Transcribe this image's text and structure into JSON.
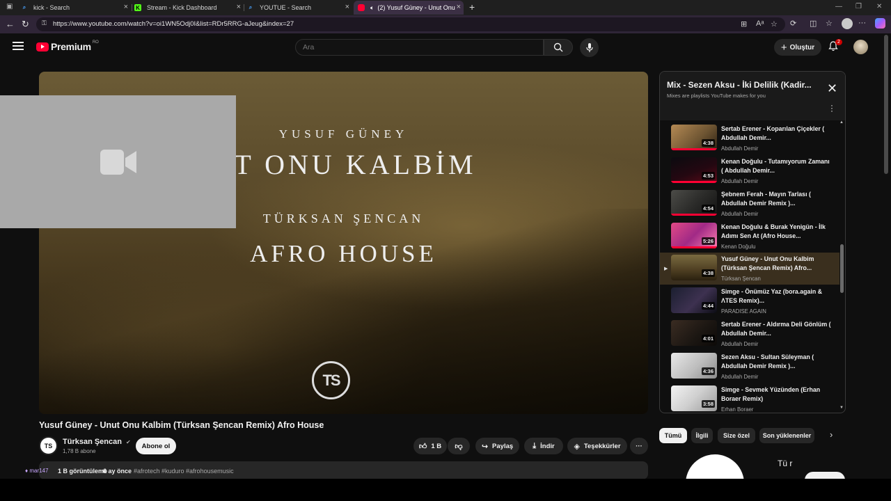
{
  "browser": {
    "tabs": [
      {
        "title": "kick - Search",
        "fav": "search-icon"
      },
      {
        "title": "Stream - Kick Dashboard",
        "fav": "K"
      },
      {
        "title": "YOUTUE - Search",
        "fav": "search-icon"
      },
      {
        "title": "(2) Yusuf Güney - Unut Onu",
        "fav": "youtube-icon"
      }
    ],
    "url": "https://www.youtube.com/watch?v=oi1WN5Odj0I&list=RDr5RRG-aJeug&index=27"
  },
  "header": {
    "logo_text": "Premium",
    "logo_region": "RO",
    "search_placeholder": "Ara",
    "create_label": "Oluştur",
    "notification_count": "2"
  },
  "video": {
    "overlay": {
      "line1": "YUSUF GÜNEY",
      "line2": "UT ONU KALBİM",
      "line3": "TÜRKSAN ŞENCAN",
      "line4": "AFRO HOUSE",
      "logo": "TS"
    },
    "title": "Yusuf Güney - Unut Onu Kalbim (Türksan Şencan Remix) Afro House",
    "channel": "Türksan Şencan",
    "channel_avatar": "TS",
    "subscribers": "1,78 B abone",
    "subscribe_label": "Abone ol",
    "likes": "1 B",
    "share_label": "Paylaş",
    "download_label": "İndir",
    "thanks_label": "Teşekkürler",
    "views": "1 B görüntüleme",
    "age": "6 ay önce",
    "hashtags": "#afrotech #kuduro #afrohousemusic",
    "chat_ghost": "mar147"
  },
  "playlist": {
    "title": "Mix - Sezen Aksu - İki Delilik (Kadir...",
    "subtitle": "Mixes are playlists YouTube makes for you",
    "items": [
      {
        "title": "Sertab Erener - Koparılan Çiçekler ( Abdullah Demir...",
        "channel": "Abdullah Demir",
        "duration": "4:38"
      },
      {
        "title": "Kenan Doğulu - Tutamıyorum Zamanı ( Abdullah Demir...",
        "channel": "Abdullah Demir",
        "duration": "4:53"
      },
      {
        "title": "Şebnem Ferah - Mayın Tarlası ( Abdullah Demir Remix )...",
        "channel": "Abdullah Demir",
        "duration": "4:54"
      },
      {
        "title": "Kenan Doğulu & Burak Yenigün - İlk Adımı Sen At (Afro House...",
        "channel": "Kenan Doğulu",
        "duration": "5:26"
      },
      {
        "title": "Yusuf Güney - Unut Onu Kalbim (Türksan Şencan Remix) Afro...",
        "channel": "Türksan Şencan",
        "duration": "4:38"
      },
      {
        "title": "Simge - Önümüz Yaz (bora.again & ΛTES Remix)...",
        "channel": "PARADISE AGAIN",
        "duration": "4:44"
      },
      {
        "title": "Sertab Erener - Aldırma Deli Gönlüm ( Abdullah Demir...",
        "channel": "Abdullah Demir",
        "duration": "4:01"
      },
      {
        "title": "Sezen Aksu - Sultan Süleyman ( Abdullah Demir Remix )...",
        "channel": "Abdullah Demir",
        "duration": "4:36"
      },
      {
        "title": "Simge - Sevmek Yüzünden (Erhan Boraer Remix)",
        "channel": "Erhan Boraer",
        "duration": "3:58"
      }
    ]
  },
  "chips": [
    "Tümü",
    "İlgili",
    "Size özel",
    "Son yüklenenler"
  ],
  "recommendation": {
    "text": "Tü r"
  },
  "colors": {
    "brand_red": "#ff0033",
    "active_row": "#3a2f1e",
    "tab_active": "#3b2f44"
  }
}
